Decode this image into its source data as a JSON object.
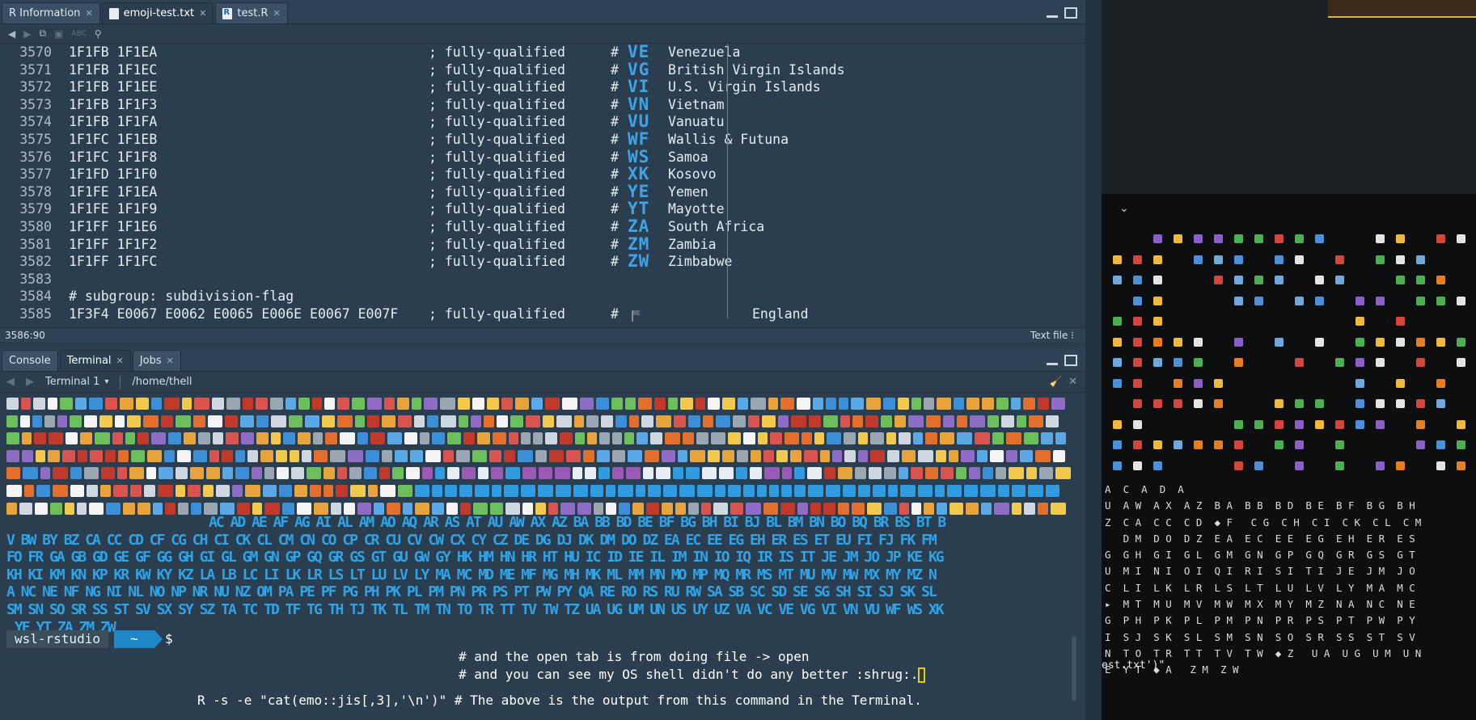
{
  "editor": {
    "tabs": [
      {
        "label": "R Information",
        "active": false
      },
      {
        "label": "emoji-test.txt",
        "active": true
      },
      {
        "label": "test.R",
        "active": false
      }
    ],
    "toolbar_icon_label": "ABC",
    "lines": [
      {
        "n": "3570",
        "cp": "1F1FB 1F1EA",
        "qual": "; fully-qualified",
        "hash": "#",
        "flag": "VE",
        "name": "Venezuela"
      },
      {
        "n": "3571",
        "cp": "1F1FB 1F1EC",
        "qual": "; fully-qualified",
        "hash": "#",
        "flag": "VG",
        "name": "British Virgin Islands"
      },
      {
        "n": "3572",
        "cp": "1F1FB 1F1EE",
        "qual": "; fully-qualified",
        "hash": "#",
        "flag": "VI",
        "name": "U.S. Virgin Islands"
      },
      {
        "n": "3573",
        "cp": "1F1FB 1F1F3",
        "qual": "; fully-qualified",
        "hash": "#",
        "flag": "VN",
        "name": "Vietnam"
      },
      {
        "n": "3574",
        "cp": "1F1FB 1F1FA",
        "qual": "; fully-qualified",
        "hash": "#",
        "flag": "VU",
        "name": "Vanuatu"
      },
      {
        "n": "3575",
        "cp": "1F1FC 1F1EB",
        "qual": "; fully-qualified",
        "hash": "#",
        "flag": "WF",
        "name": "Wallis & Futuna"
      },
      {
        "n": "3576",
        "cp": "1F1FC 1F1F8",
        "qual": "; fully-qualified",
        "hash": "#",
        "flag": "WS",
        "name": "Samoa"
      },
      {
        "n": "3577",
        "cp": "1F1FD 1F1F0",
        "qual": "; fully-qualified",
        "hash": "#",
        "flag": "XK",
        "name": "Kosovo"
      },
      {
        "n": "3578",
        "cp": "1F1FE 1F1EA",
        "qual": "; fully-qualified",
        "hash": "#",
        "flag": "YE",
        "name": "Yemen"
      },
      {
        "n": "3579",
        "cp": "1F1FE 1F1F9",
        "qual": "; fully-qualified",
        "hash": "#",
        "flag": "YT",
        "name": "Mayotte"
      },
      {
        "n": "3580",
        "cp": "1F1FF 1F1E6",
        "qual": "; fully-qualified",
        "hash": "#",
        "flag": "ZA",
        "name": "South Africa"
      },
      {
        "n": "3581",
        "cp": "1F1FF 1F1F2",
        "qual": "; fully-qualified",
        "hash": "#",
        "flag": "ZM",
        "name": "Zambia"
      },
      {
        "n": "3582",
        "cp": "1F1FF 1F1FC",
        "qual": "; fully-qualified",
        "hash": "#",
        "flag": "ZW",
        "name": "Zimbabwe"
      },
      {
        "n": "3583",
        "blank": true
      },
      {
        "n": "3584",
        "comment": "# subgroup: subdivision-flag"
      },
      {
        "n": "3585",
        "cp": "1F3F4 E0067 E0062 E0065 E006E E0067 E007F",
        "qual": "; fully-qualified",
        "hash": "#",
        "icon": "black-flag",
        "name": "England"
      }
    ],
    "status": {
      "position": "3586:90",
      "filetype": "Text file"
    }
  },
  "console": {
    "tabs": [
      {
        "label": "Console",
        "active": false
      },
      {
        "label": "Terminal",
        "active": true
      },
      {
        "label": "Jobs",
        "active": false
      }
    ],
    "terminal_selector": "Terminal 1",
    "path": "/home/thell",
    "flag_rows": [
      "AC AD AE AF AG AI AL AM AO AQ AR AS AT AU AW AX AZ BA BB BD BE BF BG BH BI BJ BL BM BN BO BQ BR BS BT B",
      "V BW BY BZ CA CC CD CF CG CH CI CK CL CM CN CO CP CR CU CV CW CX CY CZ DE DG DJ DK DM DO DZ EA EC EE EG EH ER ES ET EU FI FJ FK FM",
      "FO FR GA GB GD GE GF GG GH GI GL GM GN GP GQ GR GS GT GU GW GY HK HM HN HR HT HU IC ID IE IL IM IN IO IQ IR IS IT JE JM JO JP KE KG",
      "KH KI KM KN KP KR KW KY KZ LA LB LC LI LK LR LS LT LU LV LY MA MC MD ME MF MG MH MK ML MM MN MO MP MQ MR MS MT MU MV MW MX MY MZ N",
      "A NC NE NF NG NI NL NO NP NR NU NZ OM PA PE PF PG PH PK PL PM PN PR PS PT PW PY QA RE RO RS RU RW SA SB SC SD SE SG SH SI SJ SK SL",
      "SM SN SO SR SS ST SV SX SY SZ TA TC TD TF TG TH TJ TK TL TM TN TO TR TT TV TW TZ UA UG UM UN US UY UZ VA VC VE VG VI VN VU WF WS XK",
      "YE YT ZA ZM ZW"
    ],
    "prompt": {
      "host": "wsl-rstudio",
      "dir": "~",
      "symbol": "$"
    },
    "command": "R -s -e \"cat(emo::jis[,3],'\\n')\" # The above is the output from this command in the Terminal.",
    "comments": [
      "# and the open tab is from doing file -> open",
      "# and you can see my OS shell didn't do any better :shrug:."
    ]
  },
  "background_window": {
    "grid_rows": [
      "A  C  A  D  A",
      "U  A W  A X  A Z  B A  B B  B D  B E  B F  B G  B H",
      "Z  C A  C C  C D  ◆ F   C G  C H  C I  C K  C L  C M",
      "   D M  D O  D Z  E A  E C  E E  E G  E H  E R  E S",
      "G  G H  G I  G L  G M  G N  G P  G Q  G R  G S  G T",
      "U  M I  N I  O I  Q I  R I  S I  T I  J E  J M  J O",
      "C  L I  L K  L R  L S  L T  L U  L V  L Y  M A  M C",
      "▸  M T  M U  M V  M W  M X  M Y  M Z  N A  N C  N E",
      "G  P H  P K  P L  P M  P N  P R  P S  P T  P W  P Y",
      "I  S J  S K  S L  S M  S N  S O  S R  S S  S T  S V",
      "N  T O  T R  T T  T V  T W  ◆ Z   U A  U G  U M  U N",
      "E  Y T  ◆ A   Z M  Z W"
    ],
    "tail_text": "est.txt')\""
  }
}
